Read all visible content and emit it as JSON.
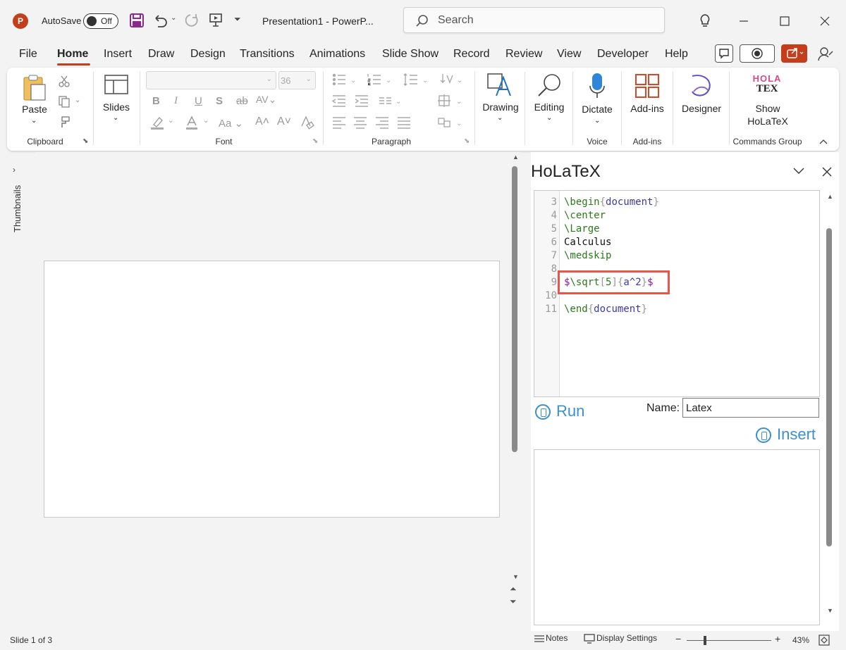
{
  "titlebar": {
    "app_icon": "P",
    "autosave_label": "AutoSave",
    "autosave_state": "Off",
    "doc_title": "Presentation1  -  PowerP...",
    "search_placeholder": "Search"
  },
  "menu": {
    "items": [
      "File",
      "Home",
      "Insert",
      "Draw",
      "Design",
      "Transitions",
      "Animations",
      "Slide Show",
      "Record",
      "Review",
      "View",
      "Developer",
      "Help"
    ],
    "active": "Home"
  },
  "ribbon": {
    "clipboard": {
      "paste": "Paste",
      "group": "Clipboard"
    },
    "slides": {
      "label": "Slides"
    },
    "font": {
      "group": "Font",
      "size": "36",
      "case_label": "Aa"
    },
    "paragraph": {
      "group": "Paragraph"
    },
    "drawing": {
      "label": "Drawing"
    },
    "editing": {
      "label": "Editing"
    },
    "voice": {
      "label": "Dictate",
      "group": "Voice"
    },
    "addins": {
      "label": "Add-ins",
      "group": "Add-ins"
    },
    "designer": {
      "label": "Designer"
    },
    "holatex": {
      "label_line1": "Show",
      "label_line2": "HoLaTeX",
      "group": "Commands Group",
      "logo_top": "HOLA",
      "logo_bottom": "TEX"
    }
  },
  "thumbnails": {
    "label": "Thumbnails"
  },
  "pane": {
    "title": "HoLaTeX",
    "code_lines": [
      {
        "n": "3"
      },
      {
        "n": "4"
      },
      {
        "n": "5"
      },
      {
        "n": "6"
      },
      {
        "n": "7"
      },
      {
        "n": "8"
      },
      {
        "n": "9"
      },
      {
        "n": "10"
      },
      {
        "n": "11"
      }
    ],
    "code": {
      "l3_cmd": "\\begin",
      "l3_arg": "document",
      "l4": "\\center",
      "l5": "\\Large",
      "l6": "Calculus",
      "l7": "\\medskip",
      "l9_dollar1": "$",
      "l9_cmd": "\\sqrt",
      "l9_opt": "5",
      "l9_arg": "a^2",
      "l9_dollar2": "$",
      "l11_cmd": "\\end",
      "l11_arg": "document"
    },
    "run_label": "Run",
    "name_label": "Name:",
    "name_value": "Latex",
    "insert_label": "Insert"
  },
  "status": {
    "slide": "Slide 1 of 3",
    "notes": "Notes",
    "display": "Display Settings",
    "zoom": "43%",
    "zoom_minus": "−",
    "zoom_plus": "+",
    "zoom_level": 0.43
  },
  "colors": {
    "accent": "#c43e1c",
    "link": "#3b8fd3",
    "highlight": "#e8554a"
  }
}
